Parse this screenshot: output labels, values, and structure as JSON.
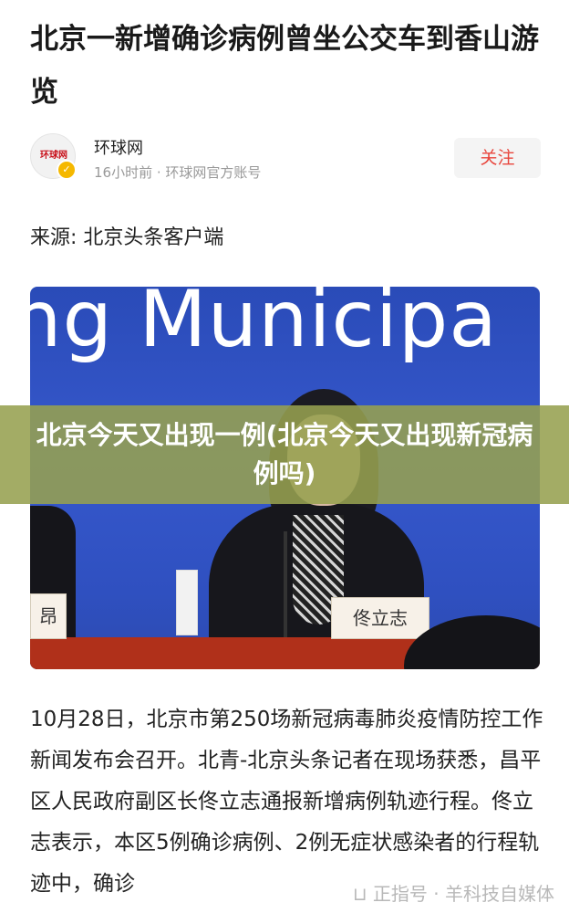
{
  "article": {
    "title": "北京一新增确诊病例曾坐公交车到香山游览",
    "author": {
      "name": "环球网",
      "avatar_text": "环球网",
      "verified_icon": "check-badge-icon",
      "meta": "16小时前 · 环球网官方账号",
      "follow_label": "关注"
    },
    "source": "来源:  北京头条客户端",
    "image": {
      "banner_text": "ng Municipa",
      "name_plate": "佟立志",
      "name_plate_left": "昂"
    },
    "overlay": "北京今天又出现一例(北京今天又出现新冠病例吗)",
    "body": "10月28日，北京市第250场新冠病毒肺炎疫情防控工作新闻发布会召开。北青-北京头条记者在现场获悉，昌平区人民政府副区长佟立志通报新增病例轨迹行程。佟立志表示，本区5例确诊病例、2例无症状感染者的行程轨迹中，确诊",
    "watermark": "⊔ 正指号 · 羊科技自媒体"
  },
  "colors": {
    "accent": "#e8453c",
    "overlay": "#96a050",
    "photo_background": "#3658cc"
  }
}
